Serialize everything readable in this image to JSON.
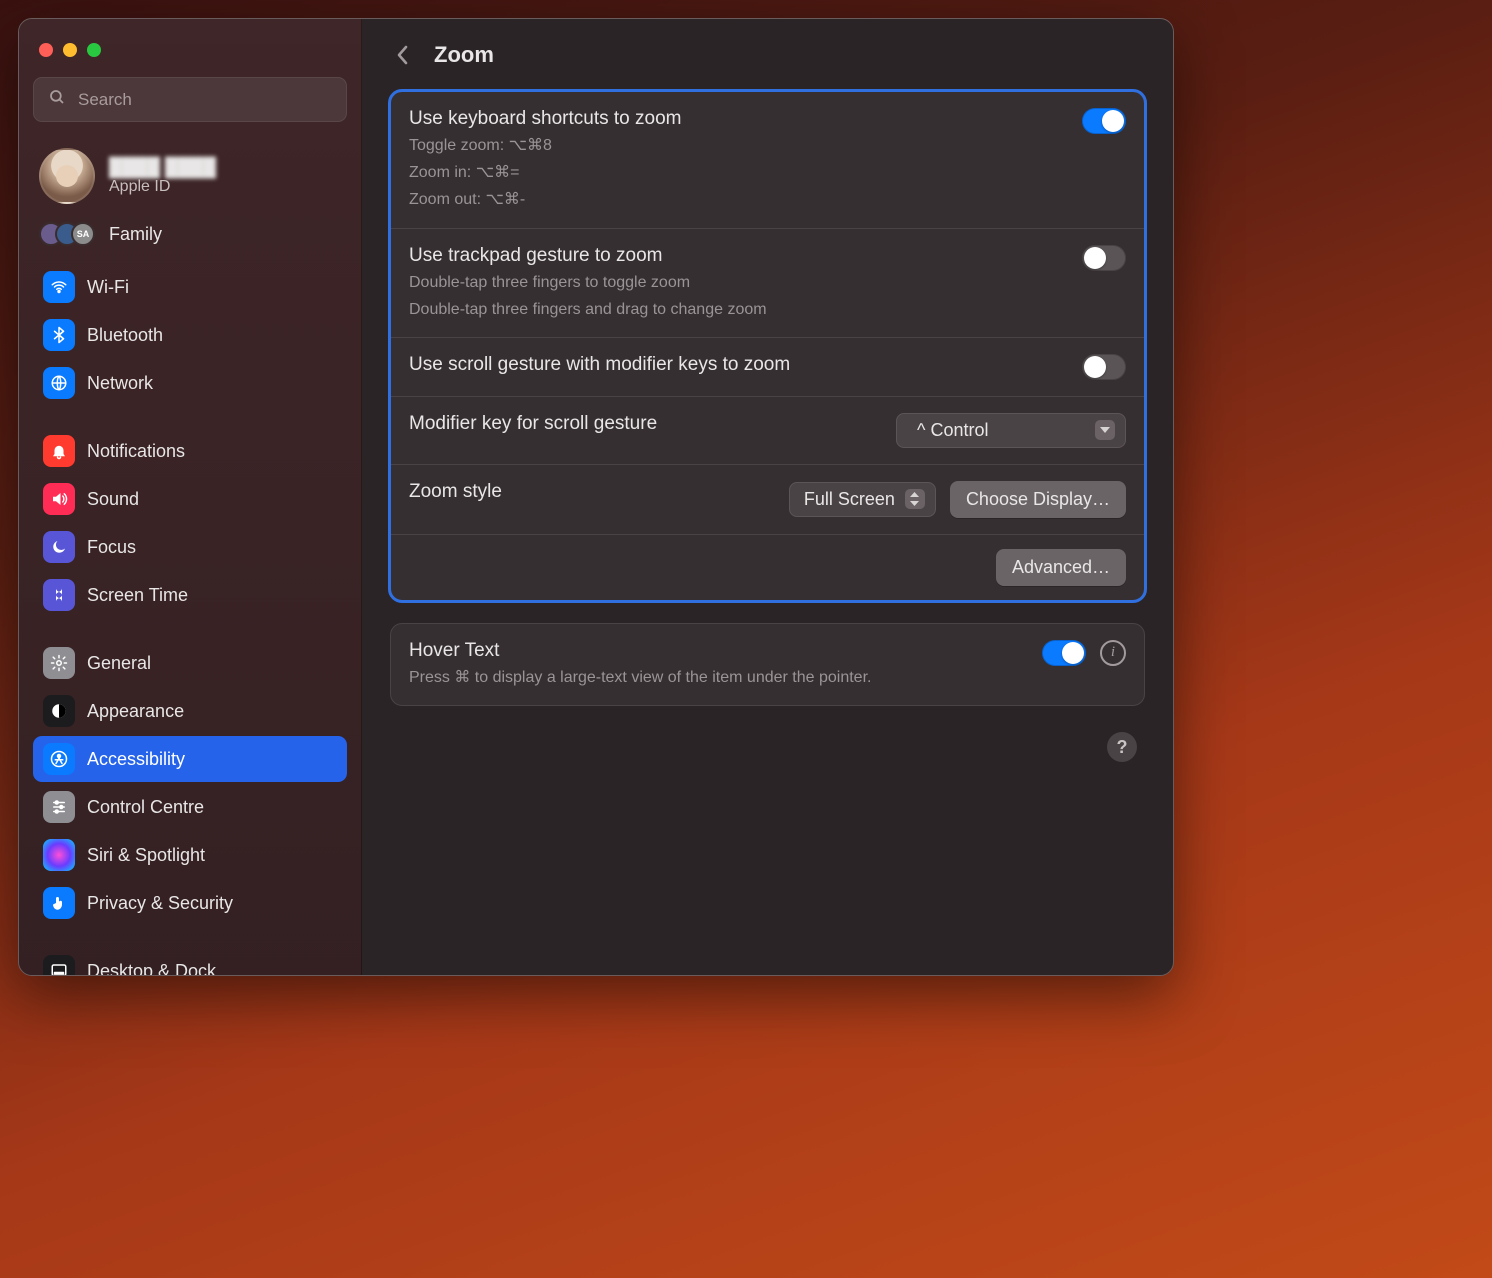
{
  "window": {
    "search_placeholder": "Search"
  },
  "account": {
    "display_name": "████ ████",
    "sub_label": "Apple ID",
    "family_label": "Family",
    "family_badge": "SA"
  },
  "sidebar": {
    "group1": [
      {
        "key": "wifi",
        "label": "Wi-Fi",
        "icon": "ic-wifi",
        "glyph": "wifi"
      },
      {
        "key": "bluetooth",
        "label": "Bluetooth",
        "icon": "ic-bt",
        "glyph": "bt"
      },
      {
        "key": "network",
        "label": "Network",
        "icon": "ic-net",
        "glyph": "globe"
      }
    ],
    "group2": [
      {
        "key": "notifications",
        "label": "Notifications",
        "icon": "ic-notif",
        "glyph": "bell"
      },
      {
        "key": "sound",
        "label": "Sound",
        "icon": "ic-sound",
        "glyph": "sound"
      },
      {
        "key": "focus",
        "label": "Focus",
        "icon": "ic-focus",
        "glyph": "moon"
      },
      {
        "key": "screentime",
        "label": "Screen Time",
        "icon": "ic-screentime",
        "glyph": "hourglass"
      }
    ],
    "group3": [
      {
        "key": "general",
        "label": "General",
        "icon": "ic-general",
        "glyph": "gear"
      },
      {
        "key": "appearance",
        "label": "Appearance",
        "icon": "ic-appearance",
        "glyph": "contrast"
      },
      {
        "key": "accessibility",
        "label": "Accessibility",
        "icon": "ic-accessibility",
        "glyph": "person",
        "selected": true
      },
      {
        "key": "controlcentre",
        "label": "Control Centre",
        "icon": "ic-controlcentre",
        "glyph": "sliders"
      },
      {
        "key": "siri",
        "label": "Siri & Spotlight",
        "icon": "ic-siri",
        "glyph": "siri"
      },
      {
        "key": "privacy",
        "label": "Privacy & Security",
        "icon": "ic-privacy",
        "glyph": "hand"
      }
    ],
    "group4": [
      {
        "key": "desktop",
        "label": "Desktop & Dock",
        "icon": "ic-desktop",
        "glyph": "dock"
      }
    ]
  },
  "header": {
    "title": "Zoom"
  },
  "main": {
    "keyboard_shortcuts": {
      "title": "Use keyboard shortcuts to zoom",
      "line1": "Toggle zoom: ⌥⌘8",
      "line2": "Zoom in: ⌥⌘=",
      "line3": "Zoom out: ⌥⌘-",
      "enabled": true
    },
    "trackpad_gesture": {
      "title": "Use trackpad gesture to zoom",
      "line1": "Double-tap three fingers to toggle zoom",
      "line2": "Double-tap three fingers and drag to change zoom",
      "enabled": false
    },
    "scroll_gesture": {
      "title": "Use scroll gesture with modifier keys to zoom",
      "enabled": false
    },
    "modifier_key": {
      "label": "Modifier key for scroll gesture",
      "value": "^ Control"
    },
    "zoom_style": {
      "label": "Zoom style",
      "value": "Full Screen",
      "choose_display": "Choose Display…"
    },
    "advanced_label": "Advanced…",
    "hover_text": {
      "title": "Hover Text",
      "desc": "Press ⌘ to display a large-text view of the item under the pointer.",
      "enabled": true
    }
  }
}
